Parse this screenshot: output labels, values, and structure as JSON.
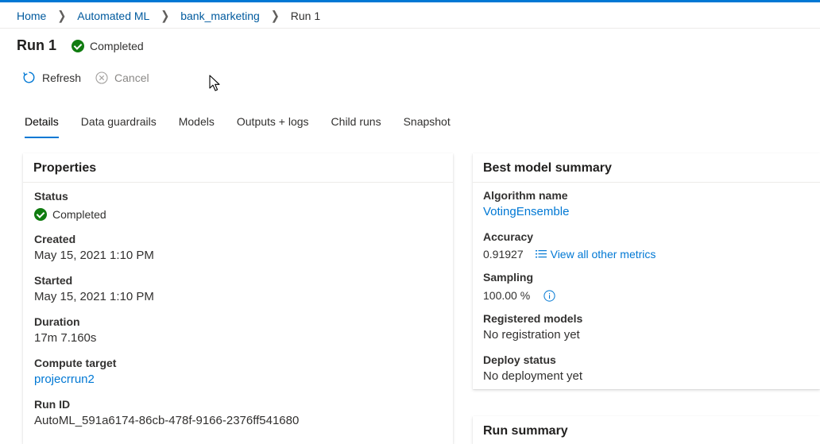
{
  "breadcrumb": {
    "items": [
      "Home",
      "Automated ML",
      "bank_marketing"
    ],
    "current": "Run 1"
  },
  "header": {
    "title": "Run 1",
    "status": "Completed"
  },
  "toolbar": {
    "refresh_label": "Refresh",
    "cancel_label": "Cancel"
  },
  "tabs": [
    "Details",
    "Data guardrails",
    "Models",
    "Outputs + logs",
    "Child runs",
    "Snapshot"
  ],
  "properties": {
    "title": "Properties",
    "status_label": "Status",
    "status_value": "Completed",
    "created_label": "Created",
    "created_value": "May 15, 2021 1:10 PM",
    "started_label": "Started",
    "started_value": "May 15, 2021 1:10 PM",
    "duration_label": "Duration",
    "duration_value": "17m 7.160s",
    "compute_label": "Compute target",
    "compute_value": "projecrrun2",
    "runid_label": "Run ID",
    "runid_value": "AutoML_591a6174-86cb-478f-9166-2376ff541680"
  },
  "best_model": {
    "title": "Best model summary",
    "algorithm_label": "Algorithm name",
    "algorithm_value": "VotingEnsemble",
    "accuracy_label": "Accuracy",
    "accuracy_value": "0.91927",
    "metrics_link": "View all other metrics",
    "sampling_label": "Sampling",
    "sampling_value": "100.00 %",
    "registered_label": "Registered models",
    "registered_value": "No registration yet",
    "deploy_label": "Deploy status",
    "deploy_value": "No deployment yet"
  },
  "run_summary": {
    "title": "Run summary"
  },
  "colors": {
    "accent": "#0078d4",
    "success": "#107c10",
    "link": "#005a9e"
  },
  "icons": [
    "check-circle-icon",
    "refresh-icon",
    "cancel-circle-icon",
    "list-icon",
    "info-icon",
    "chevron-right-icon",
    "mouse-cursor-icon"
  ]
}
